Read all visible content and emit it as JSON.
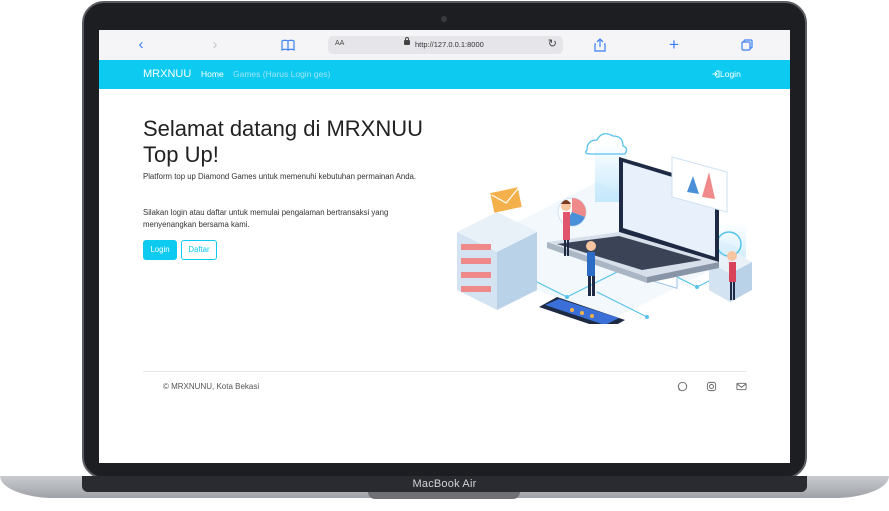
{
  "device": {
    "model_label": "MacBook Air"
  },
  "browser": {
    "text_size_label": "AA",
    "url": "http://127.0.0.1:8000"
  },
  "navbar": {
    "brand": "MRXNUU",
    "links": [
      {
        "label": "Home",
        "active": true
      },
      {
        "label": "Games (Harus Login ges)",
        "active": false
      }
    ],
    "login_label": "Login"
  },
  "hero": {
    "title": "Selamat datang di MRXNUU Top Up!",
    "paragraph1": "Platform top up Diamond Games untuk memenuhi kebutuhan permainan Anda.",
    "paragraph2": "Silakan login atau daftar untuk memulai pengalaman bertransaksi yang menyenangkan bersama kami.",
    "login_button": "Login",
    "register_button": "Daftar"
  },
  "footer": {
    "copyright": "© MRXNUNU, Kota Bekasi",
    "social_icons": [
      "whatsapp-icon",
      "instagram-icon",
      "mail-icon"
    ]
  },
  "colors": {
    "accent": "#0dcaf0",
    "browser_icon": "#3a7ef6",
    "laptop_frame": "#1d1e22"
  }
}
